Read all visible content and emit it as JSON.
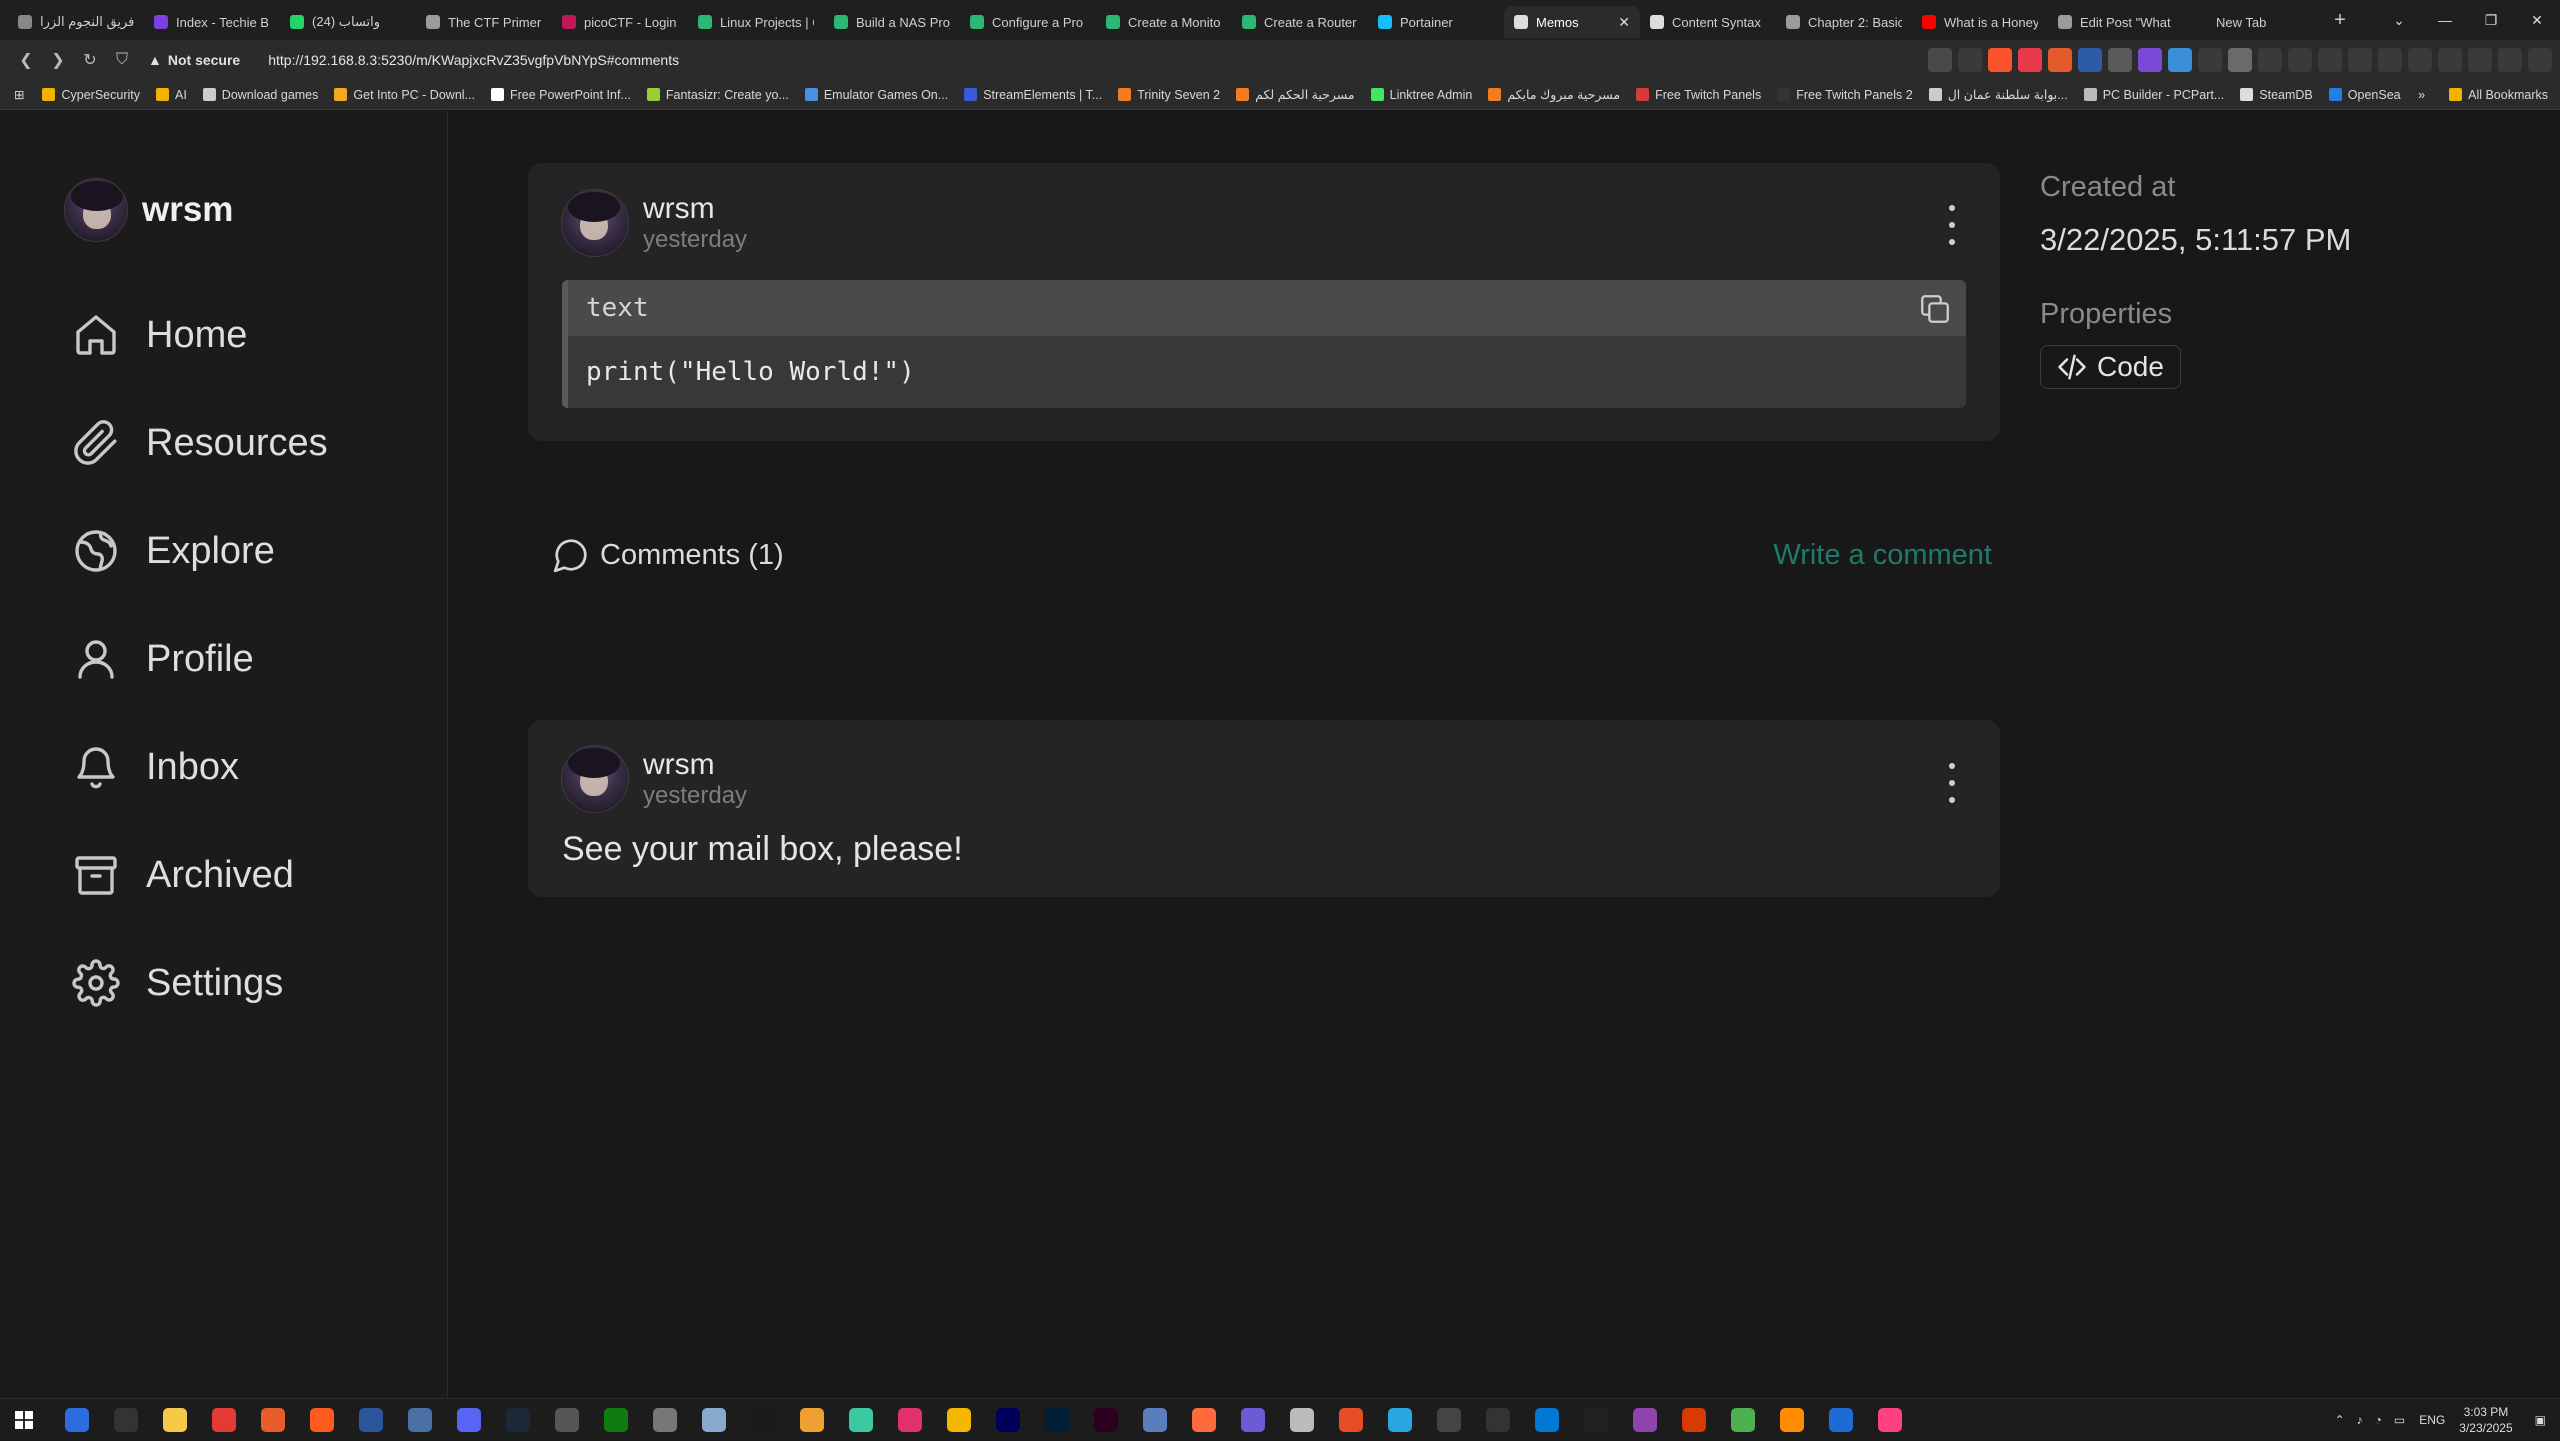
{
  "browser": {
    "tabs": [
      {
        "label": "فريق النجوم الزرا",
        "color": "#888888",
        "active": false
      },
      {
        "label": "Index - Techie B",
        "color": "#7b3fe4",
        "active": false
      },
      {
        "label": "واتساب (24)",
        "color": "#25d366",
        "active": false
      },
      {
        "label": "The CTF Primer",
        "color": "#9a9a9a",
        "active": false
      },
      {
        "label": "picoCTF - Login",
        "color": "#c2185b",
        "active": false
      },
      {
        "label": "Linux Projects | C",
        "color": "#2bb673",
        "active": false
      },
      {
        "label": "Build a NAS Proj",
        "color": "#2bb673",
        "active": false
      },
      {
        "label": "Configure a Pro",
        "color": "#2bb673",
        "active": false
      },
      {
        "label": "Create a Monito",
        "color": "#2bb673",
        "active": false
      },
      {
        "label": "Create a Router",
        "color": "#2bb673",
        "active": false
      },
      {
        "label": "Portainer",
        "color": "#13bef9",
        "active": false
      },
      {
        "label": "Memos",
        "color": "#dddddd",
        "active": true
      },
      {
        "label": "Content Syntax",
        "color": "#dddddd",
        "active": false
      },
      {
        "label": "Chapter 2: Basic",
        "color": "#9a9a9a",
        "active": false
      },
      {
        "label": "What is a Honey",
        "color": "#ff0000",
        "active": false
      },
      {
        "label": "Edit Post \"What",
        "color": "#9a9a9a",
        "active": false
      },
      {
        "label": "New Tab",
        "color": "#1f1f1f",
        "active": false
      }
    ],
    "security_label": "Not secure",
    "url": "http://192.168.8.3:5230/m/KWapjxcRvZ35vgfpVbNYpS#comments",
    "bookmarks": [
      {
        "label": "CyperSecurity",
        "color": "#f2b200"
      },
      {
        "label": "AI",
        "color": "#f2b200"
      },
      {
        "label": "Download games",
        "color": "#cccccc"
      },
      {
        "label": "Get Into PC - Downl...",
        "color": "#f5a623"
      },
      {
        "label": "Free PowerPoint Inf...",
        "color": "#ffffff"
      },
      {
        "label": "Fantasizr: Create yo...",
        "color": "#9acd32"
      },
      {
        "label": "Emulator Games On...",
        "color": "#4a90e2"
      },
      {
        "label": "StreamElements | T...",
        "color": "#3a5bd9"
      },
      {
        "label": "Trinity Seven 2",
        "color": "#f47c20"
      },
      {
        "label": "مسرحية الحكم لكم",
        "color": "#f47c20"
      },
      {
        "label": "Linktree Admin",
        "color": "#43e660"
      },
      {
        "label": "مسرحية مبروك مايكم",
        "color": "#f47c20"
      },
      {
        "label": "Free Twitch Panels",
        "color": "#d63b3b"
      },
      {
        "label": "Free Twitch Panels 2",
        "color": "#333333"
      },
      {
        "label": "بوابة سلطنة عمان ال...",
        "color": "#cccccc"
      },
      {
        "label": "PC Builder - PCPart...",
        "color": "#bbbbbb"
      },
      {
        "label": "SteamDB",
        "color": "#dddddd"
      },
      {
        "label": "OpenSea",
        "color": "#2081e2"
      }
    ],
    "all_bookmarks_label": "All Bookmarks"
  },
  "sidebar": {
    "username": "wrsm",
    "items": [
      {
        "label": "Home",
        "icon": "home-icon"
      },
      {
        "label": "Resources",
        "icon": "paperclip-icon"
      },
      {
        "label": "Explore",
        "icon": "globe-icon"
      },
      {
        "label": "Profile",
        "icon": "user-icon"
      },
      {
        "label": "Inbox",
        "icon": "bell-icon"
      },
      {
        "label": "Archived",
        "icon": "archive-icon"
      },
      {
        "label": "Settings",
        "icon": "gear-icon"
      }
    ]
  },
  "memo": {
    "author": "wrsm",
    "time": "yesterday",
    "code_lang": "text",
    "code": "print(\"Hello World!\")"
  },
  "comments": {
    "title": "Comments (1)",
    "write_label": "Write a comment",
    "items": [
      {
        "author": "wrsm",
        "time": "yesterday",
        "text": "See your mail box, please!"
      }
    ]
  },
  "details": {
    "created_label": "Created at",
    "created_value": "3/22/2025, 5:11:57 PM",
    "properties_label": "Properties",
    "property_chip": "Code"
  },
  "taskbar": {
    "apps": [
      "#2d6cdf",
      "#333333",
      "#f7c948",
      "#e53935",
      "#e85d2c",
      "#ff5a1f",
      "#2b579a",
      "#4a6fa5",
      "#5865f2",
      "#1b2838",
      "#555555",
      "#107c10",
      "#777777",
      "#88aacc",
      "#1a1a1a",
      "#f0a030",
      "#3cc8a0",
      "#e1306c",
      "#f5b800",
      "#00005b",
      "#001e36",
      "#2e001f",
      "#5a7dbd",
      "#ff6a3d",
      "#6b5bd6",
      "#bbbbbb",
      "#e44d26",
      "#2aa7e0",
      "#444444",
      "#333333",
      "#0078d4",
      "#222222",
      "#8e44ad",
      "#d83b01",
      "#4caf50",
      "#ff8c00",
      "#1e6bd6",
      "#ff4081"
    ],
    "lang": "ENG",
    "time": "3:03 PM",
    "date": "3/23/2025"
  },
  "colors": {
    "accent": "#1f7a6b",
    "background": "#181818",
    "card": "#242424"
  }
}
